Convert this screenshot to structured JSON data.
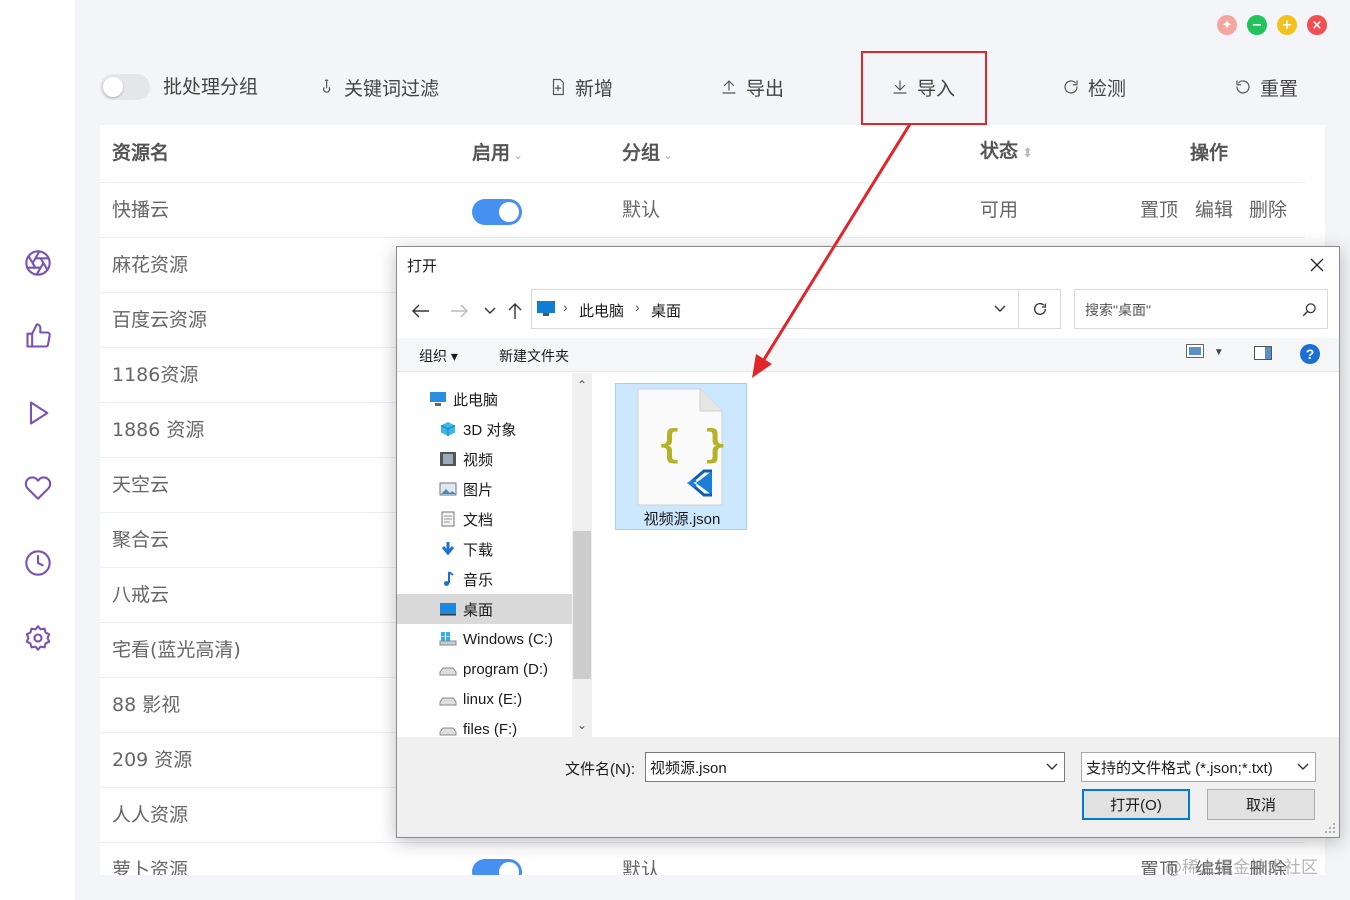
{
  "toolbar": {
    "batch_group_label": "批处理分组",
    "keyword_filter": "关键词过滤",
    "add": "新增",
    "export": "导出",
    "import": "导入",
    "detect": "检测",
    "reset": "重置"
  },
  "table": {
    "headers": {
      "name": "资源名",
      "enabled": "启用",
      "group": "分组",
      "status": "状态",
      "actions": "操作"
    },
    "rows": [
      {
        "name": "快播云",
        "enabled": true,
        "group": "默认",
        "status": "可用",
        "actions": [
          "置顶",
          "编辑",
          "删除"
        ]
      },
      {
        "name": "麻花资源"
      },
      {
        "name": "百度云资源"
      },
      {
        "name": "1186资源"
      },
      {
        "name": "1886 资源"
      },
      {
        "name": "天空云"
      },
      {
        "name": "聚合云"
      },
      {
        "name": "八戒云"
      },
      {
        "name": "宅看(蓝光高清)"
      },
      {
        "name": "88 影视"
      },
      {
        "name": "209 资源"
      },
      {
        "name": "人人资源"
      },
      {
        "name": "萝卜资源",
        "enabled": true,
        "group": "默认",
        "actions": [
          "置顶",
          "编辑",
          "删除"
        ]
      }
    ]
  },
  "dialog": {
    "title": "打开",
    "breadcrumb": [
      "此电脑",
      "桌面"
    ],
    "search_placeholder": "搜索\"桌面\"",
    "organize": "组织",
    "new_folder": "新建文件夹",
    "tree": [
      {
        "label": "此电脑",
        "icon": "computer-icon"
      },
      {
        "label": "3D 对象",
        "icon": "cube-icon"
      },
      {
        "label": "视频",
        "icon": "video-icon"
      },
      {
        "label": "图片",
        "icon": "picture-icon"
      },
      {
        "label": "文档",
        "icon": "document-icon"
      },
      {
        "label": "下载",
        "icon": "download-icon"
      },
      {
        "label": "音乐",
        "icon": "music-icon"
      },
      {
        "label": "桌面",
        "icon": "desktop-icon",
        "selected": true
      },
      {
        "label": "Windows (C:)",
        "icon": "windows-drive-icon"
      },
      {
        "label": "program (D:)",
        "icon": "drive-icon"
      },
      {
        "label": "linux (E:)",
        "icon": "drive-icon"
      },
      {
        "label": "files (F:)",
        "icon": "drive-icon"
      }
    ],
    "file": {
      "name": "视频源.json",
      "glyph": "{ }"
    },
    "filename_label": "文件名(N):",
    "filename_value": "视频源.json",
    "filetype": "支持的文件格式 (*.json;*.txt)",
    "open_button": "打开(O)",
    "cancel_button": "取消"
  },
  "watermark": "@稀土掘金技术社区",
  "colors": {
    "accent": "#4590f0",
    "rail_icon": "#7a52b3",
    "highlight": "#e0262b"
  }
}
